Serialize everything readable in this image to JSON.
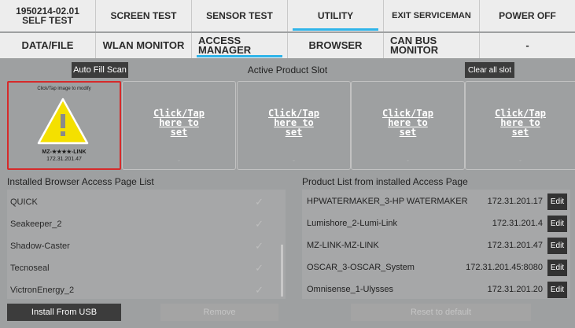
{
  "tabs_row1": [
    {
      "line1": "1950214-02.01",
      "line2": "SELF TEST",
      "active": false
    },
    {
      "label": "SCREEN TEST",
      "active": false
    },
    {
      "label": "SENSOR TEST",
      "active": false
    },
    {
      "label": "UTILITY",
      "active": true
    },
    {
      "label": "EXIT SERVICEMAN",
      "active": false
    },
    {
      "label": "POWER OFF",
      "active": false
    }
  ],
  "tabs_row2": [
    {
      "label": "DATA/FILE",
      "active": false
    },
    {
      "label": "WLAN MONITOR",
      "active": false
    },
    {
      "line1": "ACCESS",
      "line2": "MANAGER",
      "active": true
    },
    {
      "label": "BROWSER",
      "active": false
    },
    {
      "line1": "CAN BUS",
      "line2": "MONITOR",
      "active": false
    },
    {
      "label": "-",
      "active": false
    }
  ],
  "toolbar": {
    "auto_fill_label": "Auto Fill Scan",
    "active_slot_title": "Active Product Slot",
    "clear_all_label": "Clear all slot"
  },
  "slots": {
    "first": {
      "hint": "Click/Tap image to modify",
      "icon": "warning-triangle-icon",
      "name": "MZ-★★★★-LINK",
      "ip": "172.31.201.47"
    },
    "others": [
      {
        "link": "Click/Tap here to set",
        "dash": "-"
      },
      {
        "link": "Click/Tap here to set",
        "dash": "-"
      },
      {
        "link": "Click/Tap here to set",
        "dash": "-"
      },
      {
        "link": "Click/Tap here to set",
        "dash": "-"
      }
    ]
  },
  "installed": {
    "title": "Installed Browser Access Page List",
    "items": [
      "QUICK",
      "Seakeeper_2",
      "Shadow-Caster",
      "Tecnoseal",
      "VictronEnergy_2"
    ],
    "check_icon": "check-icon",
    "install_label": "Install From USB",
    "remove_label": "Remove"
  },
  "products": {
    "title": "Product List from installed Access Page",
    "items": [
      {
        "name": "HPWATERMAKER_3-HP WATERMAKER",
        "ip": "172.31.201.17",
        "edit": "Edit"
      },
      {
        "name": "Lumishore_2-Lumi-Link",
        "ip": "172.31.201.4",
        "edit": "Edit"
      },
      {
        "name": "MZ-LINK-MZ-LINK",
        "ip": "172.31.201.47",
        "edit": "Edit"
      },
      {
        "name": "OSCAR_3-OSCAR_System",
        "ip": "172.31.201.45:8080",
        "edit": "Edit"
      },
      {
        "name": "Omnisense_1-Ulysses",
        "ip": "172.31.201.20",
        "edit": "Edit"
      }
    ],
    "reset_label": "Reset to default"
  },
  "colors": {
    "accent": "#2fb4e9",
    "highlight_border": "#d62a2a",
    "warning": "#f4e000"
  }
}
